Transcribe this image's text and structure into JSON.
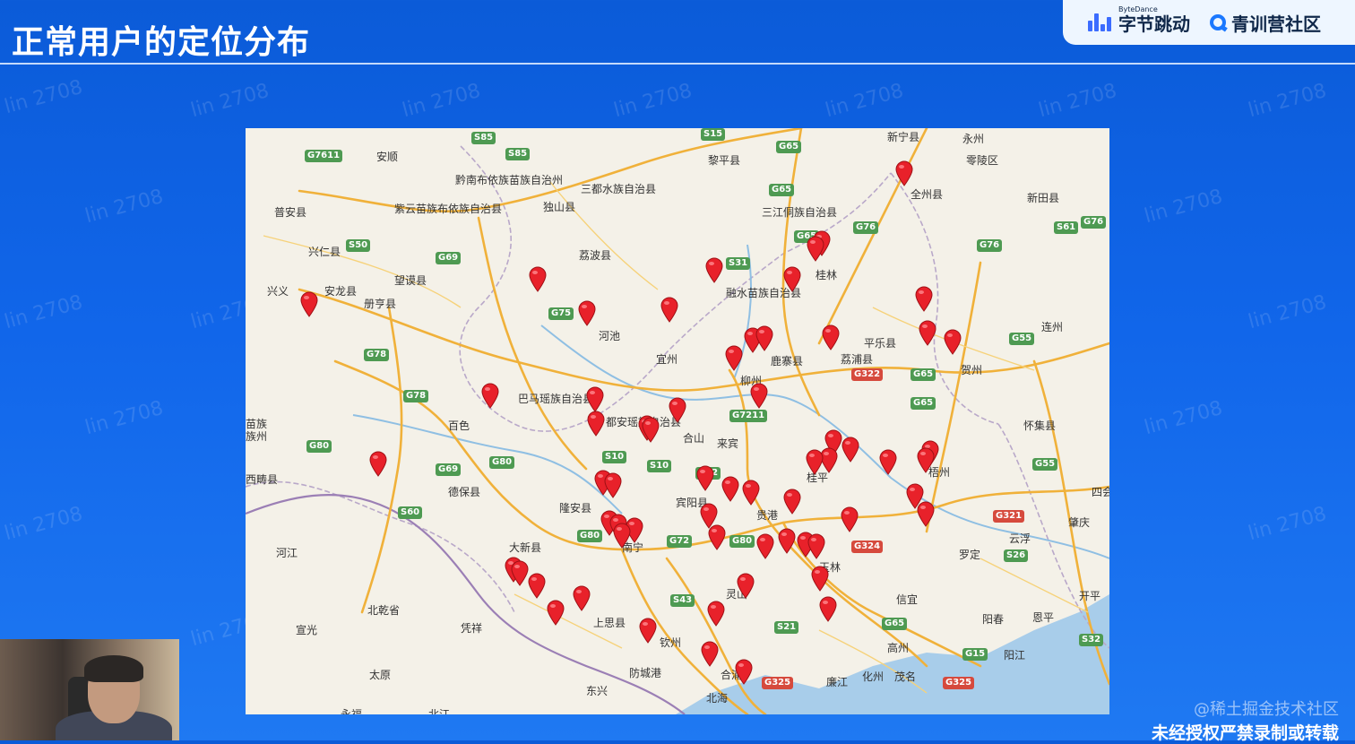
{
  "slide": {
    "title": "正常用户的定位分布"
  },
  "brand": {
    "bytedance_sub": "ByteDance",
    "bytedance_name": "字节跳动",
    "community_name": "青训营社区"
  },
  "watermark_text": "lin 2708",
  "map": {
    "labels": [
      "安顺",
      "黔南布依族苗族自治州",
      "三都水族自治县",
      "独山县",
      "黎平县",
      "三江侗族自治县",
      "新宁县",
      "永州",
      "零陵区",
      "全州县",
      "新田县",
      "紫云苗族布依族自治县",
      "普安县",
      "兴仁县",
      "望谟县",
      "荔波县",
      "兴义",
      "安龙县",
      "册亨县",
      "融水苗族自治县",
      "桂林",
      "平乐县",
      "河池",
      "宜州",
      "鹿寨县",
      "荔浦县",
      "连州",
      "贺州",
      "巴马瑶族自治县",
      "都安瑶族自治县",
      "百色",
      "合山",
      "来宾",
      "怀集县",
      "西畴县",
      "德保县",
      "柳州",
      "梧州",
      "宾阳县",
      "贵港",
      "四会",
      "肇庆",
      "隆安县",
      "大新县",
      "南宁",
      "云浮",
      "罗定",
      "河江",
      "玉林",
      "灵山",
      "开平",
      "北乾省",
      "凭祥",
      "上思县",
      "钦州",
      "阳春",
      "恩平",
      "宣光",
      "防城港",
      "信宜",
      "高州",
      "阳江",
      "太原",
      "东兴",
      "合浦",
      "北海",
      "廉江",
      "化州",
      "茂名",
      "永福",
      "北江",
      "苗族",
      "族州",
      "桂平"
    ],
    "highway_labels": [
      "S85",
      "S85",
      "G7611",
      "G65",
      "S15",
      "G65",
      "G65",
      "G76",
      "G322",
      "S50",
      "G69",
      "S31",
      "G76",
      "S61",
      "G76",
      "G75",
      "G55",
      "G78",
      "G65",
      "G65",
      "G78",
      "G7211",
      "G80",
      "G69",
      "G80",
      "S10",
      "S10",
      "G72",
      "G55",
      "S60",
      "G80",
      "G321",
      "G72",
      "G80",
      "G324",
      "S26",
      "S43",
      "S21",
      "G65",
      "S32",
      "G15",
      "G325",
      "G325"
    ]
  },
  "icons": {
    "marker": "map-pin-icon"
  },
  "colors": {
    "marker": "#e8212a",
    "background": "#1166ea"
  },
  "footer": {
    "community": "@稀土掘金技术社区",
    "notice": "未经授权严禁录制或转载"
  }
}
